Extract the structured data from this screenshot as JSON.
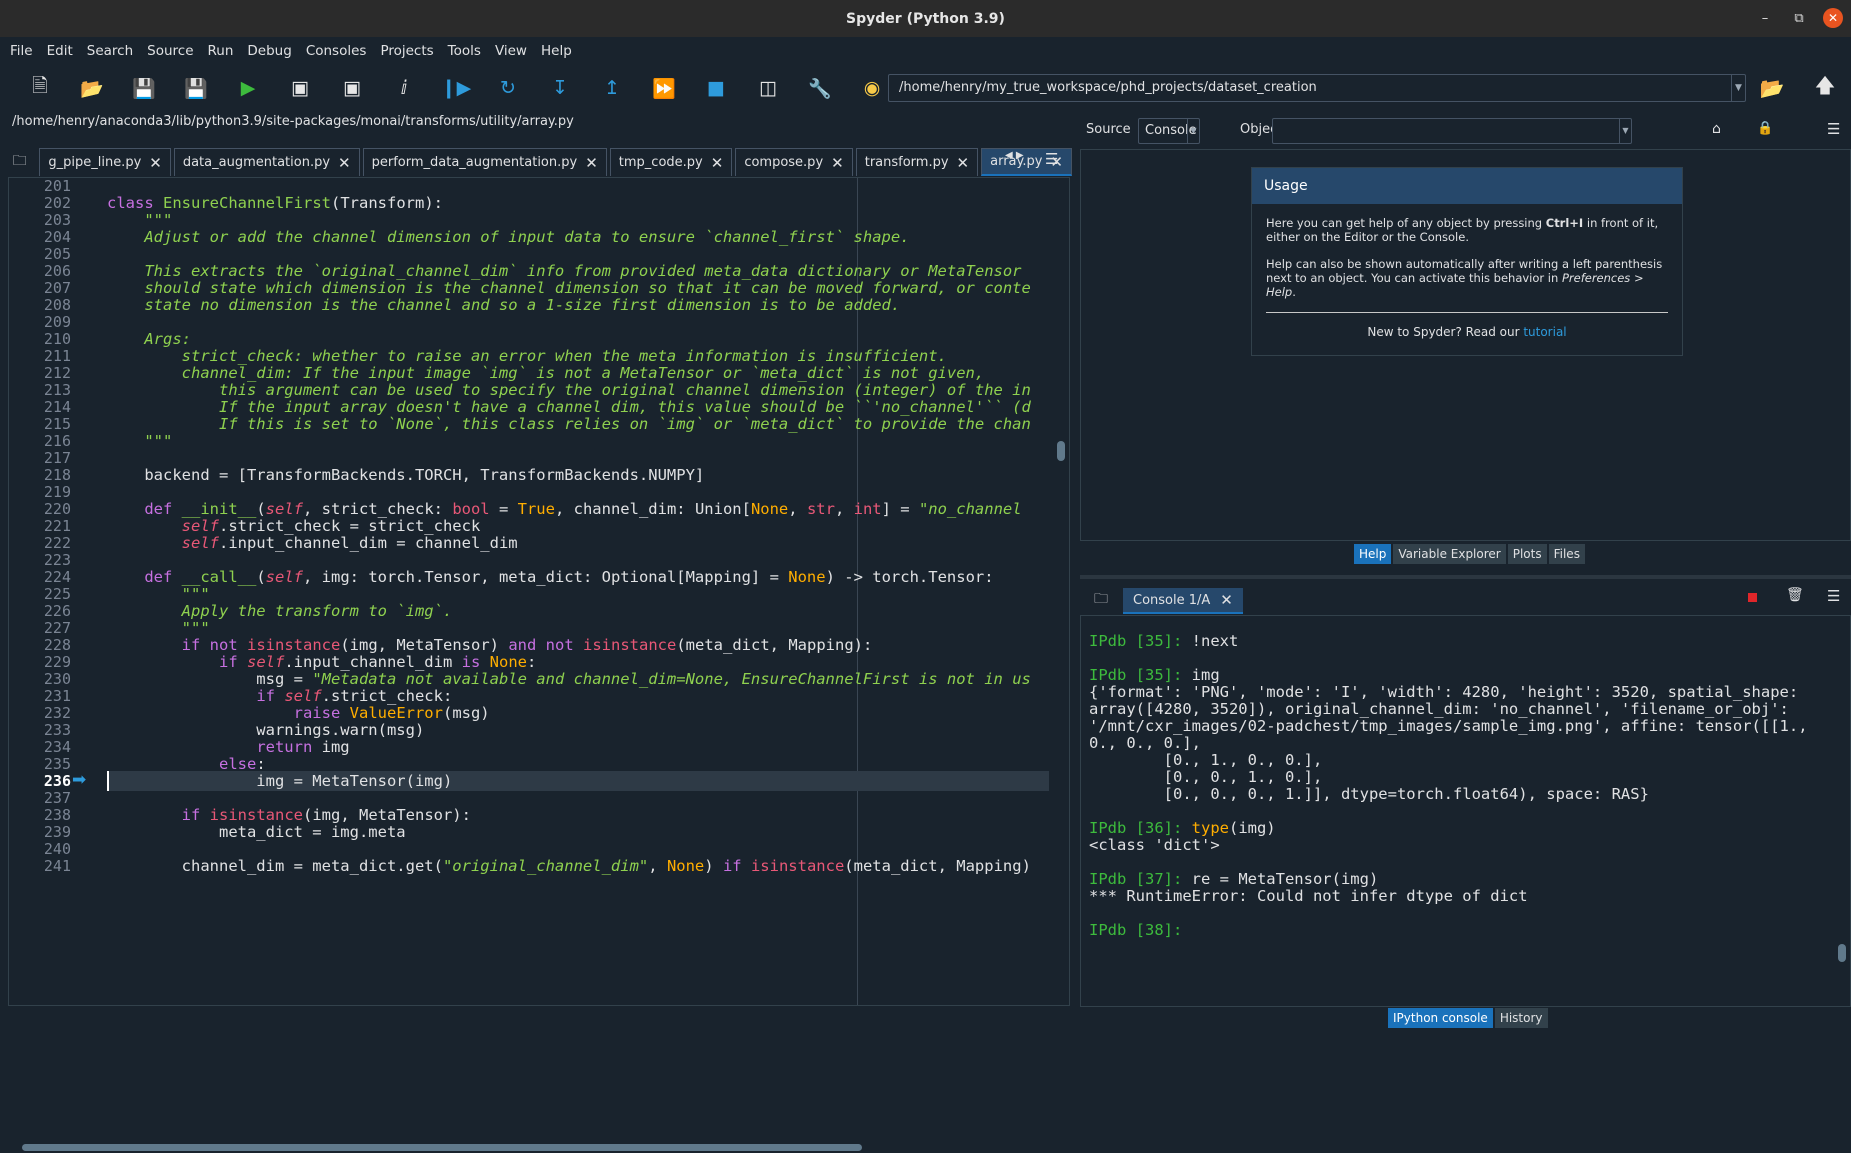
{
  "window": {
    "title": "Spyder (Python 3.9)"
  },
  "menu": [
    "File",
    "Edit",
    "Search",
    "Source",
    "Run",
    "Debug",
    "Consoles",
    "Projects",
    "Tools",
    "View",
    "Help"
  ],
  "toolbar": {
    "path": "/home/henry/my_true_workspace/phd_projects/dataset_creation"
  },
  "editor": {
    "file_path": "/home/henry/anaconda3/lib/python3.9/site-packages/monai/transforms/utility/array.py",
    "tabs": [
      {
        "label": "g_pipe_line.py",
        "active": false
      },
      {
        "label": "data_augmentation.py",
        "active": false
      },
      {
        "label": "perform_data_augmentation.py",
        "active": false
      },
      {
        "label": "tmp_code.py",
        "active": false
      },
      {
        "label": "compose.py",
        "active": false
      },
      {
        "label": "transform.py",
        "active": false
      },
      {
        "label": "array.py",
        "active": true
      }
    ],
    "current_line": "236",
    "lines": [
      {
        "n": "201",
        "html": ""
      },
      {
        "n": "202",
        "html": "<span class='k'>class</span> <span class='cls'>EnsureChannelFirst</span>(Transform):"
      },
      {
        "n": "203",
        "html": "    <span class='doc'>\"\"\"</span>"
      },
      {
        "n": "204",
        "html": "    <span class='doc'>Adjust or add the channel dimension of input data to ensure `channel_first` shape.</span>"
      },
      {
        "n": "205",
        "html": ""
      },
      {
        "n": "206",
        "html": "    <span class='doc'>This extracts the `original_channel_dim` info from provided meta_data dictionary or MetaTensor</span>"
      },
      {
        "n": "207",
        "html": "    <span class='doc'>should state which dimension is the channel dimension so that it can be moved forward, or conte</span>"
      },
      {
        "n": "208",
        "html": "    <span class='doc'>state no dimension is the channel and so a 1-size first dimension is to be added.</span>"
      },
      {
        "n": "209",
        "html": ""
      },
      {
        "n": "210",
        "html": "    <span class='doc'>Args:</span>"
      },
      {
        "n": "211",
        "html": "        <span class='doc'>strict_check: whether to raise an error when the meta information is insufficient.</span>"
      },
      {
        "n": "212",
        "html": "        <span class='doc'>channel_dim: If the input image `img` is not a MetaTensor or `meta_dict` is not given,</span>"
      },
      {
        "n": "213",
        "html": "            <span class='doc'>this argument can be used to specify the original channel dimension (integer) of the in</span>"
      },
      {
        "n": "214",
        "html": "            <span class='doc'>If the input array doesn't have a channel dim, this value should be ``'no_channel'`` (d</span>"
      },
      {
        "n": "215",
        "html": "            <span class='doc'>If this is set to `None`, this class relies on `img` or `meta_dict` to provide the chan</span>"
      },
      {
        "n": "216",
        "html": "    <span class='doc'>\"\"\"</span>"
      },
      {
        "n": "217",
        "html": ""
      },
      {
        "n": "218",
        "html": "    backend = [TransformBackends.TORCH, TransformBackends.NUMPY]"
      },
      {
        "n": "219",
        "html": ""
      },
      {
        "n": "220",
        "html": "    <span class='k'>def</span> <span class='fn'>__init__</span>(<span class='slf'>self</span>, strict_check: <span class='bi'>bool</span> = <span class='cn'>True</span>, channel_dim: Union[<span class='cn'>None</span>, <span class='bi'>str</span>, <span class='bi'>int</span>] = <span class='str'>\"no_channel</span>"
      },
      {
        "n": "221",
        "html": "        <span class='slf'>self</span>.strict_check = strict_check"
      },
      {
        "n": "222",
        "html": "        <span class='slf'>self</span>.input_channel_dim = channel_dim"
      },
      {
        "n": "223",
        "html": ""
      },
      {
        "n": "224",
        "html": "    <span class='k'>def</span> <span class='fn'>__call__</span>(<span class='slf'>self</span>, img: torch.Tensor, meta_dict: Optional[Mapping] = <span class='cn'>None</span>) -&gt; torch.Tensor:"
      },
      {
        "n": "225",
        "html": "        <span class='doc'>\"\"\"</span>"
      },
      {
        "n": "226",
        "html": "        <span class='doc'>Apply the transform to `img`.</span>"
      },
      {
        "n": "227",
        "html": "        <span class='doc'>\"\"\"</span>"
      },
      {
        "n": "228",
        "html": "        <span class='k'>if</span> <span class='k'>not</span> <span class='bi'>isinstance</span>(img, MetaTensor) <span class='k'>and</span> <span class='k'>not</span> <span class='bi'>isinstance</span>(meta_dict, Mapping):"
      },
      {
        "n": "229",
        "html": "            <span class='k'>if</span> <span class='slf'>self</span>.input_channel_dim <span class='k'>is</span> <span class='cn'>None</span>:"
      },
      {
        "n": "230",
        "html": "                msg = <span class='str'>\"Metadata not available and channel_dim=None, EnsureChannelFirst is not in us</span>"
      },
      {
        "n": "231",
        "html": "                <span class='k'>if</span> <span class='slf'>self</span>.strict_check:"
      },
      {
        "n": "232",
        "html": "                    <span class='k'>raise</span> <span class='cn'>ValueError</span>(msg)"
      },
      {
        "n": "233",
        "html": "                warnings.warn(msg)"
      },
      {
        "n": "234",
        "html": "                <span class='k'>return</span> img"
      },
      {
        "n": "235",
        "html": "            <span class='k'>else</span>:"
      },
      {
        "n": "236",
        "html": "                img = MetaTensor(img)"
      },
      {
        "n": "237",
        "html": ""
      },
      {
        "n": "238",
        "html": "        <span class='k'>if</span> <span class='bi'>isinstance</span>(img, MetaTensor):"
      },
      {
        "n": "239",
        "html": "            meta_dict = img.meta"
      },
      {
        "n": "240",
        "html": ""
      },
      {
        "n": "241",
        "html": "        channel_dim = meta_dict.get(<span class='str'>\"original_channel_dim\"</span>, <span class='cn'>None</span>) <span class='k'>if</span> <span class='bi'>isinstance</span>(meta_dict, Mapping)"
      }
    ]
  },
  "help": {
    "source_label": "Source",
    "source_value": "Console",
    "object_label": "Object",
    "usage_title": "Usage",
    "usage_p1_a": "Here you can get help of any object by pressing ",
    "usage_p1_b": "Ctrl+I",
    "usage_p1_c": " in front of it, either on the Editor or the Console.",
    "usage_p2_a": "Help can also be shown automatically after writing a left parenthesis next to an object. You can activate this behavior in ",
    "usage_p2_b": "Preferences > Help",
    "usage_p2_c": ".",
    "usage_footer": "New to Spyder? Read our ",
    "usage_link": "tutorial",
    "tabs": [
      {
        "label": "Help",
        "active": true
      },
      {
        "label": "Variable Explorer",
        "active": false
      },
      {
        "label": "Plots",
        "active": false
      },
      {
        "label": "Files",
        "active": false
      }
    ]
  },
  "console": {
    "tab": "Console 1/A",
    "lines": [
      {
        "html": ""
      },
      {
        "html": "<span class='pr'>IPdb [35]: </span>!next"
      },
      {
        "html": ""
      },
      {
        "html": "<span class='pr'>IPdb [35]: </span>img"
      },
      {
        "html": "{'format': 'PNG', 'mode': 'I', 'width': 4280, 'height': 3520, spatial_shape:"
      },
      {
        "html": "array([4280, 3520]), original_channel_dim: 'no_channel', 'filename_or_obj':"
      },
      {
        "html": "'/mnt/cxr_images/02-padchest/tmp_images/sample_img.png', affine: tensor([[1.,"
      },
      {
        "html": "0., 0., 0.],"
      },
      {
        "html": "        [0., 1., 0., 0.],"
      },
      {
        "html": "        [0., 0., 1., 0.],"
      },
      {
        "html": "        [0., 0., 0., 1.]], dtype=torch.float64), space: RAS}"
      },
      {
        "html": ""
      },
      {
        "html": "<span class='pr'>IPdb [36]: </span><span class='cbi'>type</span>(img)"
      },
      {
        "html": "&lt;class 'dict'&gt;"
      },
      {
        "html": ""
      },
      {
        "html": "<span class='pr'>IPdb [37]: </span>re = MetaTensor(img)"
      },
      {
        "html": "*** RuntimeError: Could not infer dtype of dict"
      },
      {
        "html": ""
      },
      {
        "html": "<span class='pr'>IPdb [38]: </span>"
      }
    ],
    "bottom_tabs": [
      {
        "label": "IPython console",
        "active": true
      },
      {
        "label": "History",
        "active": false
      }
    ]
  },
  "icons": {
    "new": "new-file-icon",
    "open": "open-folder-icon",
    "save": "save-icon",
    "saveall": "save-all-icon",
    "run": "run-icon",
    "runcell": "run-cell-icon",
    "runcelladv": "run-cell-advance-icon",
    "runsel": "run-selection-icon",
    "debug": "debug-icon",
    "step": "step-icon",
    "stepin": "step-into-icon",
    "stepout": "step-out-icon",
    "continue": "continue-icon",
    "stop": "stop-icon",
    "maximize": "maximize-pane-icon",
    "prefs": "wrench-icon",
    "pythonpath": "python-path-icon"
  }
}
